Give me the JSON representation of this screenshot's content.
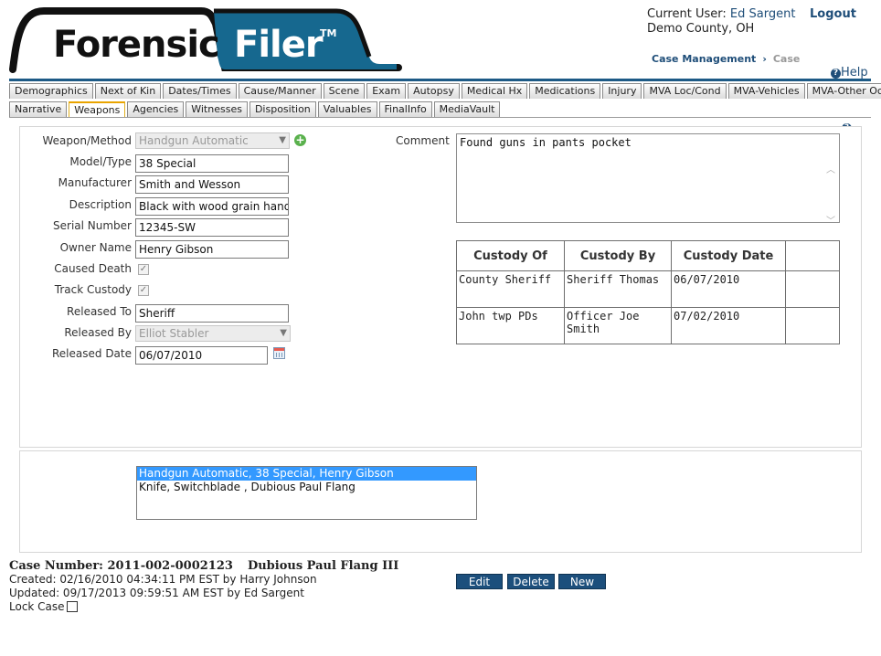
{
  "header": {
    "logo_dark": "Forensic",
    "logo_light": "Filer",
    "logo_tm": "TM",
    "current_user_label": "Current User:",
    "current_user_name": "Ed Sargent",
    "logout_label": "Logout",
    "county": "Demo County, OH",
    "breadcrumb": [
      "Case Management",
      "Case"
    ],
    "help_label": "Help"
  },
  "tabs_row1": [
    "Demographics",
    "Next of Kin",
    "Dates/Times",
    "Cause/Manner",
    "Scene",
    "Exam",
    "Autopsy",
    "Medical Hx",
    "Medications",
    "Injury",
    "MVA Loc/Cond",
    "MVA-Vehicles",
    "MVA-Other Occs"
  ],
  "tabs_row2": [
    "Narrative",
    "Weapons",
    "Agencies",
    "Witnesses",
    "Disposition",
    "Valuables",
    "FinalInfo",
    "MediaVault"
  ],
  "active_tab": "Weapons",
  "form": {
    "weapon_method": {
      "label": "Weapon/Method",
      "value": "Handgun Automatic"
    },
    "model_type": {
      "label": "Model/Type",
      "value": "38 Special"
    },
    "manufacturer": {
      "label": "Manufacturer",
      "value": "Smith and Wesson"
    },
    "description": {
      "label": "Description",
      "value": "Black with wood grain handle"
    },
    "serial_number": {
      "label": "Serial Number",
      "value": "12345-SW"
    },
    "owner_name": {
      "label": "Owner Name",
      "value": "Henry Gibson"
    },
    "caused_death": {
      "label": "Caused Death",
      "checked": true
    },
    "track_custody": {
      "label": "Track Custody",
      "checked": true
    },
    "released_to": {
      "label": "Released To",
      "value": "Sheriff"
    },
    "released_by": {
      "label": "Released By",
      "value": "Elliot Stabler"
    },
    "released_date": {
      "label": "Released Date",
      "value": "06/07/2010"
    },
    "comment": {
      "label": "Comment",
      "value": "Found guns in pants pocket"
    }
  },
  "custody": {
    "columns": [
      "Custody Of",
      "Custody By",
      "Custody Date",
      ""
    ],
    "rows": [
      [
        "County Sheriff",
        "Sheriff Thomas",
        "06/07/2010",
        ""
      ],
      [
        "John twp PDs",
        "Officer Joe Smith",
        "07/02/2010",
        ""
      ]
    ]
  },
  "weapon_list": [
    "Handgun Automatic, 38 Special, Henry Gibson",
    "Knife, Switchblade , Dubious Paul Flang"
  ],
  "footer": {
    "case_number_label": "Case Number: 2011-002-0002123",
    "case_name": "Dubious Paul Flang III",
    "created": "Created: 02/16/2010 04:34:11 PM EST by Harry Johnson",
    "updated": "Updated: 09/17/2013 09:59:51 AM EST by Ed Sargent",
    "lock_label": "Lock Case"
  },
  "buttons": {
    "edit": "Edit",
    "delete": "Delete",
    "new": "New"
  },
  "colors": {
    "brand_navy": "#1d5a86",
    "brand_teal": "#16688f",
    "button_bg": "#1c4f7c",
    "active_tab_accent": "#e9a400",
    "list_selected": "#3399ff"
  }
}
